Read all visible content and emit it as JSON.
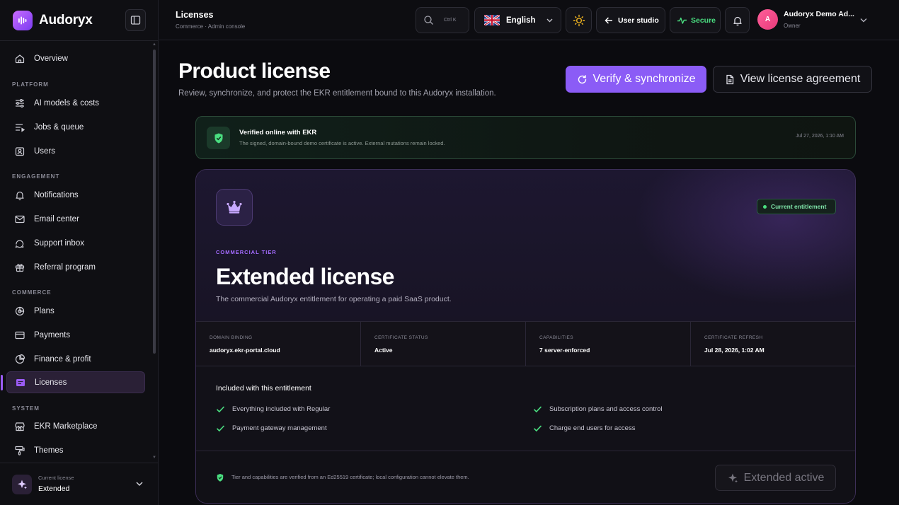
{
  "brand": {
    "name": "Audoryx"
  },
  "sidebar": {
    "items": [
      {
        "label": "Overview"
      },
      {
        "label": "AI models & costs"
      },
      {
        "label": "Jobs & queue"
      },
      {
        "label": "Users"
      },
      {
        "label": "Notifications"
      },
      {
        "label": "Email center"
      },
      {
        "label": "Support inbox"
      },
      {
        "label": "Referral program"
      },
      {
        "label": "Plans"
      },
      {
        "label": "Payments"
      },
      {
        "label": "Finance & profit"
      },
      {
        "label": "Licenses"
      },
      {
        "label": "EKR Marketplace"
      },
      {
        "label": "Themes"
      }
    ],
    "sections": [
      "PLATFORM",
      "ENGAGEMENT",
      "COMMERCE",
      "SYSTEM"
    ],
    "license": {
      "label": "Current license",
      "value": "Extended"
    }
  },
  "topbar": {
    "title": "Licenses",
    "subtitle": "Commerce · Admin console",
    "search_kbd": "Ctrl K",
    "language": "English",
    "user_studio": "User studio",
    "secure": "Secure",
    "user": {
      "initial": "A",
      "name": "Audoryx Demo Ad...",
      "role": "Owner"
    }
  },
  "page": {
    "title": "Product license",
    "subtitle": "Review, synchronize, and protect the EKR entitlement bound to this Audoryx installation.",
    "verify_button": "Verify & synchronize",
    "agreement_button": "View license agreement"
  },
  "verified": {
    "title": "Verified online with EKR",
    "description": "The signed, domain-bound demo certificate is active. External mutations remain locked.",
    "time": "Jul 27, 2026, 1:10 AM"
  },
  "license": {
    "badge": "Current entitlement",
    "tier_label": "COMMERCIAL TIER",
    "tier_title": "Extended license",
    "tier_desc": "The commercial Audoryx entitlement for operating a paid SaaS product.",
    "stats": [
      {
        "label": "DOMAIN BINDING",
        "value": "audoryx.ekr-portal.cloud"
      },
      {
        "label": "CERTIFICATE STATUS",
        "value": "Active"
      },
      {
        "label": "CAPABILITIES",
        "value": "7 server-enforced"
      },
      {
        "label": "CERTIFICATE REFRESH",
        "value": "Jul 28, 2026, 1:02 AM"
      }
    ],
    "included_title": "Included with this entitlement",
    "included": [
      "Everything included with Regular",
      "Subscription plans and access control",
      "Payment gateway management",
      "Charge end users for access"
    ],
    "footer_note": "Tier and capabilities are verified from an Ed25519 certificate; local configuration cannot elevate them.",
    "active_button": "Extended active"
  },
  "colors": {
    "accent": "#8b5cf6",
    "success": "#4ade80",
    "background": "#0b0b0f"
  }
}
